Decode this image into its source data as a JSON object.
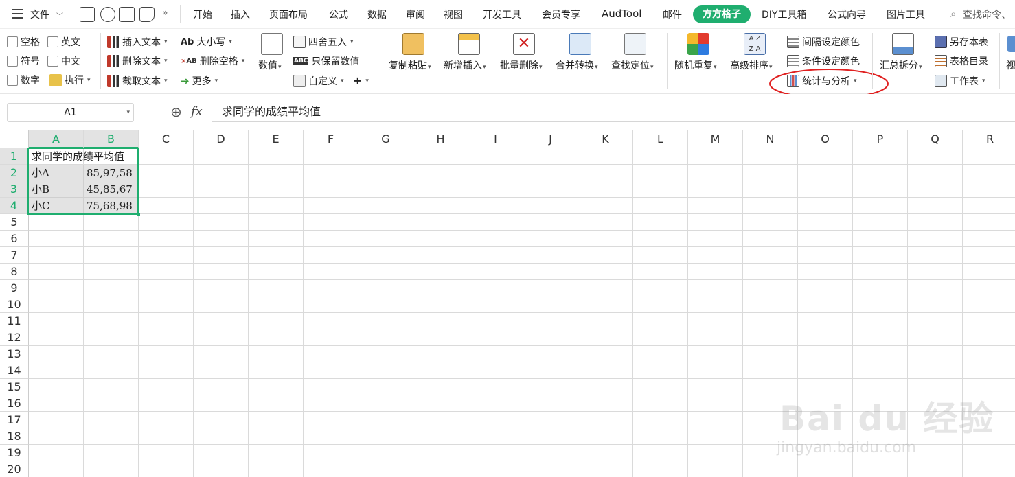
{
  "menu": {
    "file_label": "文件",
    "tabs": [
      "开始",
      "插入",
      "页面布局",
      "公式",
      "数据",
      "审阅",
      "视图",
      "开发工具",
      "会员专享",
      "AudTool",
      "邮件",
      "方方格子",
      "DIY工具箱",
      "公式向导",
      "图片工具"
    ],
    "active_tab": "方方格子",
    "search_placeholder": "查找命令、"
  },
  "ribbon": {
    "group1": {
      "kongge": "空格",
      "yingwen": "英文",
      "fuhao": "符号",
      "zhongwen": "中文",
      "shuzi": "数字",
      "zhixing": "执行"
    },
    "group2": {
      "insert_text": "插入文本",
      "delete_text": "删除文本",
      "cut_text": "截取文本"
    },
    "group3": {
      "case": "大小写",
      "delete_space": "删除空格",
      "more": "更多"
    },
    "group4": {
      "value": "数值",
      "round": "四舍五入",
      "keep_value": "只保留数值",
      "custom": "自定义",
      "plus": "+"
    },
    "group5": {
      "copy_paste": "复制粘贴",
      "new_insert": "新增插入",
      "batch_delete": "批量删除",
      "merge_convert": "合并转换",
      "find_locate": "查找定位"
    },
    "group6": {
      "random": "随机重复",
      "adv_sort": "高级排序",
      "interval_color": "间隔设定颜色",
      "cond_color": "条件设定颜色",
      "stat_analysis": "统计与分析"
    },
    "group7": {
      "summary_split": "汇总拆分",
      "save_as": "另存本表",
      "sheet_catalog": "表格目录",
      "worksheet": "工作表",
      "view": "视"
    }
  },
  "formula_bar": {
    "name_box": "A1",
    "fx": "fx",
    "content": "求同学的成绩平均值"
  },
  "sheet": {
    "columns": [
      "A",
      "B",
      "C",
      "D",
      "E",
      "F",
      "G",
      "H",
      "I",
      "J",
      "K",
      "L",
      "M",
      "N",
      "O",
      "P",
      "Q",
      "R"
    ],
    "rows": [
      "1",
      "2",
      "3",
      "4",
      "5",
      "6",
      "7",
      "8",
      "9",
      "10",
      "11",
      "12",
      "13",
      "14",
      "15",
      "16",
      "17",
      "18",
      "19",
      "20"
    ],
    "cells": {
      "A1": "求同学的成绩平均值",
      "A2": "小A",
      "B2": "85,97,58",
      "A3": "小B",
      "B3": "45,85,67",
      "A4": "小C",
      "B4": "75,68,98"
    }
  },
  "watermark": {
    "brand": "Bai du 经验",
    "url": "jingyan.baidu.com"
  },
  "colors": {
    "accent": "#1fae6f",
    "annotation": "#e02020",
    "header_highlight": "#1fae6f"
  }
}
